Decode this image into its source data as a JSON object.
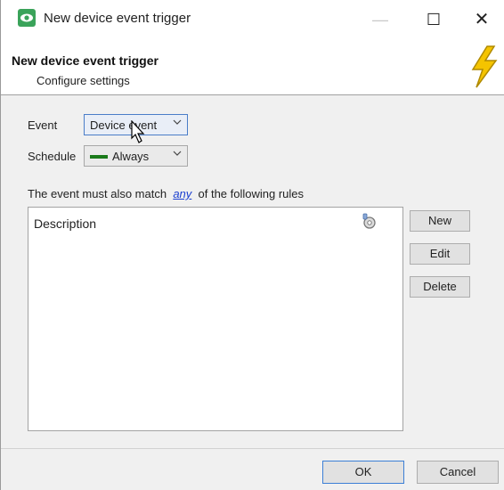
{
  "window": {
    "title": "New device event trigger",
    "controls": {
      "minimize": "—",
      "maximize": "☐",
      "close": "✕"
    }
  },
  "header": {
    "title": "New device event trigger",
    "subtitle": "Configure settings"
  },
  "form": {
    "event_label": "Event",
    "event_value": "Device event",
    "schedule_label": "Schedule",
    "schedule_value": "Always",
    "schedule_color": "#1a7a1a"
  },
  "rules": {
    "prefix": "The event must also match",
    "match_mode": "any",
    "suffix": "of the following rules",
    "list_header": "Description"
  },
  "buttons": {
    "new": "New",
    "edit": "Edit",
    "delete": "Delete",
    "ok": "OK",
    "cancel": "Cancel"
  },
  "colors": {
    "accent": "#3c7fd6",
    "link": "#1a3fd0",
    "bolt": "#f5c400"
  }
}
